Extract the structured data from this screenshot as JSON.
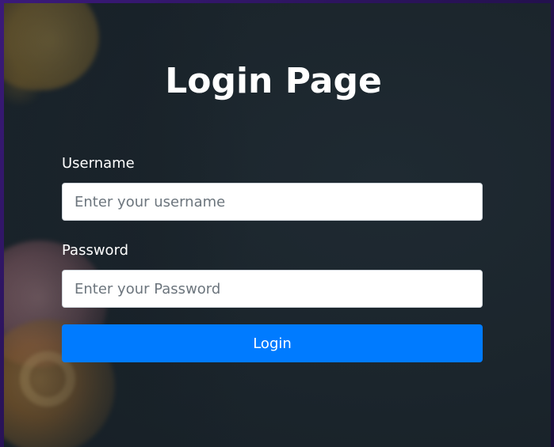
{
  "page": {
    "title": "Login Page"
  },
  "form": {
    "username": {
      "label": "Username",
      "placeholder": "Enter your username",
      "value": ""
    },
    "password": {
      "label": "Password",
      "placeholder": "Enter your Password",
      "value": ""
    },
    "submit_label": "Login"
  },
  "colors": {
    "accent": "#007bff",
    "panel_background": "#1b252c",
    "outer_background": "#2a0e5a",
    "text": "#ffffff"
  }
}
